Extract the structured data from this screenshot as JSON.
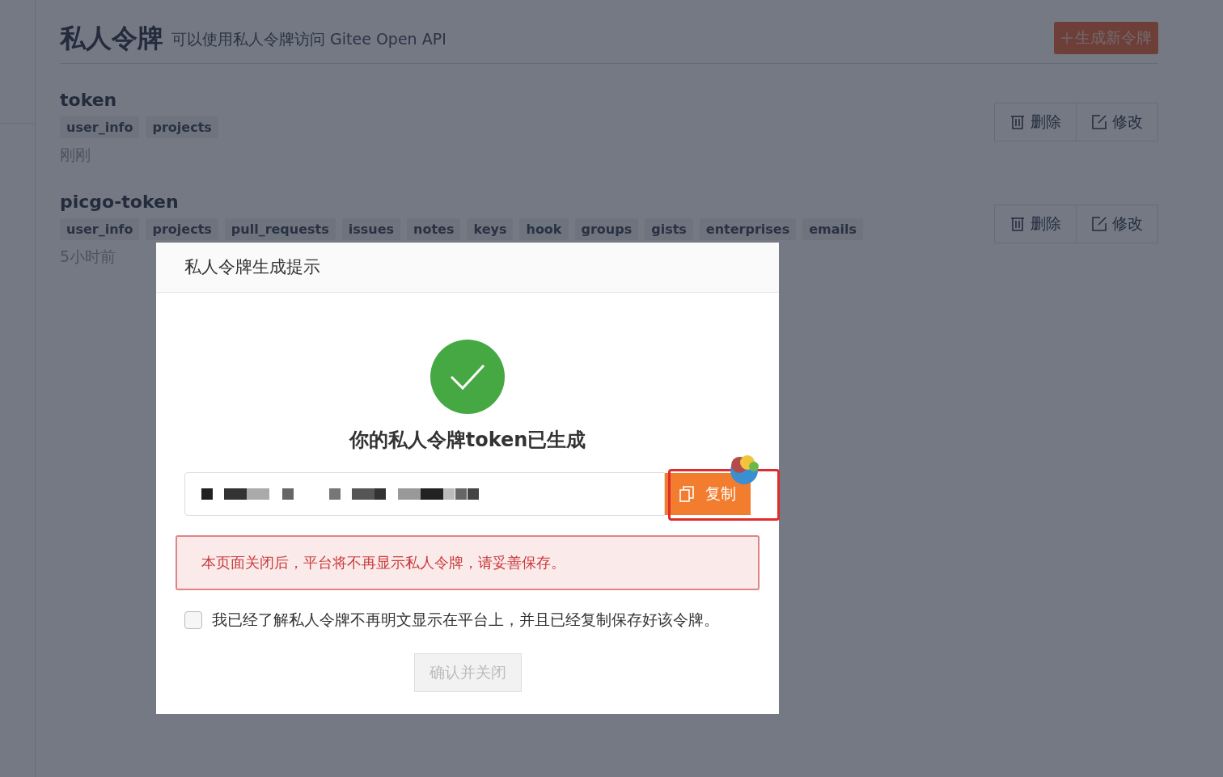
{
  "header": {
    "title": "私人令牌",
    "subtitle": "可以使用私人令牌访问 Gitee Open API",
    "new_button": "生成新令牌"
  },
  "tokens": [
    {
      "name": "token",
      "scopes": [
        "user_info",
        "projects"
      ],
      "time": "刚刚",
      "actions": [
        "删除",
        "修改"
      ]
    },
    {
      "name": "picgo-token",
      "scopes": [
        "user_info",
        "projects",
        "pull_requests",
        "issues",
        "notes",
        "keys",
        "hook",
        "groups",
        "gists",
        "enterprises",
        "emails"
      ],
      "time": "5小时前",
      "actions": [
        "删除",
        "修改"
      ]
    }
  ],
  "modal": {
    "title": "私人令牌生成提示",
    "heading": "你的私人令牌token已生成",
    "copy_button": "复制",
    "copy_highlighted": true,
    "warning": "本页面关闭后，平台将不再显示私人令牌，请妥善保存。",
    "checkbox": {
      "label": "我已经了解私人令牌不再明文显示在平台上，并且已经复制保存好该令牌。",
      "checked": false
    },
    "confirm": {
      "label": "确认并关闭",
      "disabled": true
    }
  }
}
